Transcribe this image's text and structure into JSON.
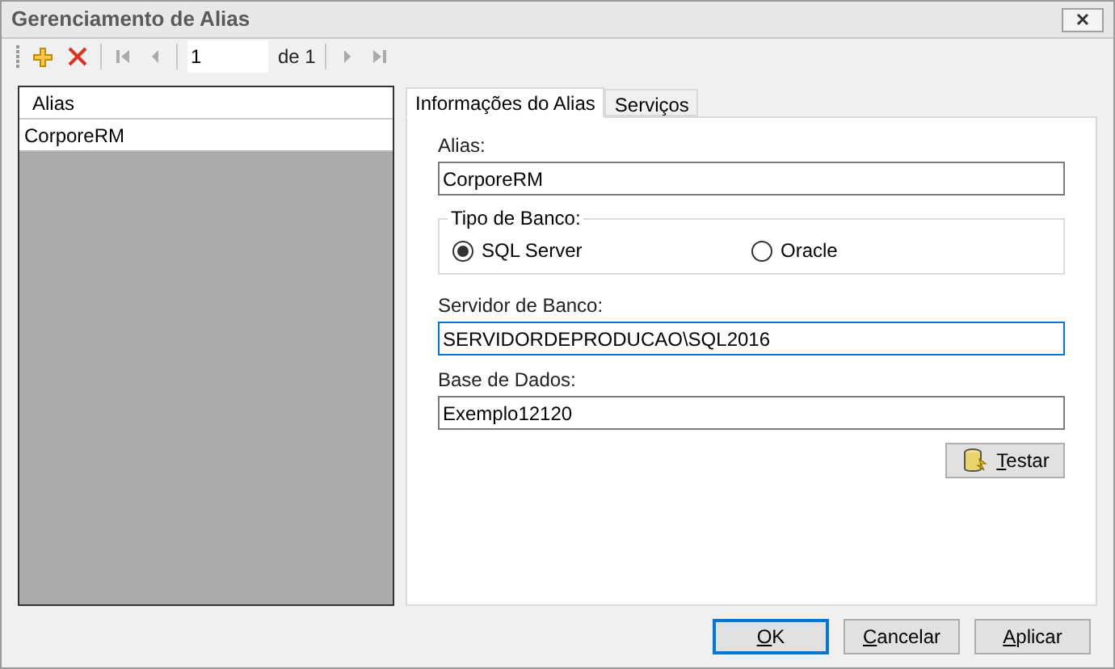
{
  "window": {
    "title": "Gerenciamento de Alias"
  },
  "toolbar": {
    "page_value": "1",
    "page_total": "de 1"
  },
  "alias_list": {
    "header": "Alias",
    "rows": [
      {
        "label": "CorporeRM",
        "selected": true
      }
    ]
  },
  "tabs": [
    {
      "label": "Informações do Alias",
      "selected": true
    },
    {
      "label": "Serviços",
      "selected": false
    }
  ],
  "alias_field": {
    "label": "Alias:",
    "value": "CorporeRM",
    "focused": false
  },
  "bank_type": {
    "legend": "Tipo de Banco:",
    "options": [
      {
        "label": "SQL Server",
        "selected": true
      },
      {
        "label": "Oracle",
        "selected": false
      }
    ]
  },
  "server_field": {
    "label": "Servidor de Banco:",
    "value": "SERVIDORDEPRODUCAO\\SQL2016",
    "focused": true
  },
  "database_field": {
    "label": "Base de Dados:",
    "value": "Exemplo12120",
    "focused": false
  },
  "test_button": {
    "label": "Testar"
  },
  "buttons": [
    {
      "label": "OK",
      "default": true
    },
    {
      "label": "Cancelar",
      "default": false
    },
    {
      "label": "Aplicar",
      "default": false
    }
  ]
}
